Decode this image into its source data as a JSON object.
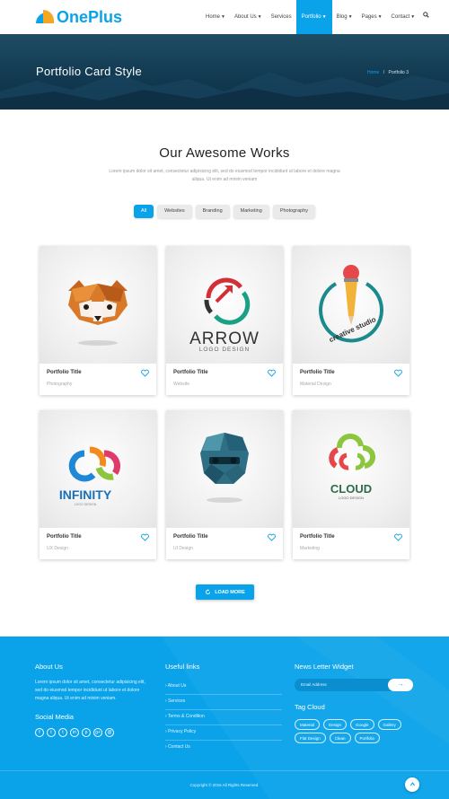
{
  "brand": {
    "name": "OnePlus",
    "accent": "#0aa3ea",
    "accent2": "#f5a623"
  },
  "nav": {
    "items": [
      {
        "label": "Home",
        "dropdown": true,
        "active": false
      },
      {
        "label": "About Us",
        "dropdown": true,
        "active": false
      },
      {
        "label": "Services",
        "dropdown": false,
        "active": false
      },
      {
        "label": "Portfolio",
        "dropdown": true,
        "active": true
      },
      {
        "label": "Blog",
        "dropdown": true,
        "active": false
      },
      {
        "label": "Pages",
        "dropdown": true,
        "active": false
      },
      {
        "label": "Contact",
        "dropdown": true,
        "active": false
      }
    ],
    "search_icon": "search-icon"
  },
  "banner": {
    "title": "Portfolio Card Style",
    "breadcrumb_home": "Home",
    "breadcrumb_sep": "/",
    "breadcrumb_current": "Portfolio 3"
  },
  "works": {
    "title": "Our Awesome Works",
    "description": "Lorem ipsum dolor sit amet, consectetur adipisicing elit, sed do eiusmod tempor incididunt ut labore et dolore magna aliqua. Ut enim ad minim veniam",
    "filters": [
      "All",
      "Websites",
      "Branding",
      "Marketing",
      "Photography"
    ],
    "active_filter": "All",
    "cards": [
      {
        "title": "Portfolio Title",
        "category": "Photography",
        "image": "red-panda-logo"
      },
      {
        "title": "Portfolio Title",
        "category": "Website",
        "image": "arrow-logo",
        "logo_text": "ARROW",
        "logo_sub": "LOGO DESIGN"
      },
      {
        "title": "Portfolio Title",
        "category": "Material Design",
        "image": "creative-studio-logo",
        "logo_text": "creative studio"
      },
      {
        "title": "Portfolio Title",
        "category": "UX Design",
        "image": "infinity-logo",
        "logo_text": "INFINITY",
        "logo_sub": "LOGO DESIGN"
      },
      {
        "title": "Portfolio Title",
        "category": "UI Design",
        "image": "monster-logo"
      },
      {
        "title": "Portfolio Title",
        "category": "Marketing",
        "image": "cloud-logo",
        "logo_text": "CLOUD",
        "logo_sub": "LOGO DESIGN"
      }
    ],
    "load_more": "LOAD MORE"
  },
  "footer": {
    "about_title": "About Us",
    "about_text": "Lorem ipsum dolor sit amet, consectetur adipisicing elit, sed do eiusmod tempor incididunt ut labore et dolore magna aliqua. Ut enim ad minim veniam.",
    "social_title": "Social Media",
    "social": [
      "f",
      "t",
      "t",
      "in",
      "p",
      "g+",
      "@"
    ],
    "links_title": "Useful links",
    "links": [
      "About Us",
      "Services",
      "Terms & Condition",
      "Privacy Policy",
      "Contact Us"
    ],
    "newsletter_title": "News Letter Widget",
    "newsletter_placeholder": "Email Address",
    "newsletter_button": "→",
    "tags_title": "Tag Cloud",
    "tags": [
      "Material",
      "Design",
      "Google",
      "Gallery",
      "Flat Design",
      "Clean",
      "Portfolio"
    ],
    "copyright": "Copyright © 2016 All Rights Reserved.",
    "to_top": "^"
  }
}
